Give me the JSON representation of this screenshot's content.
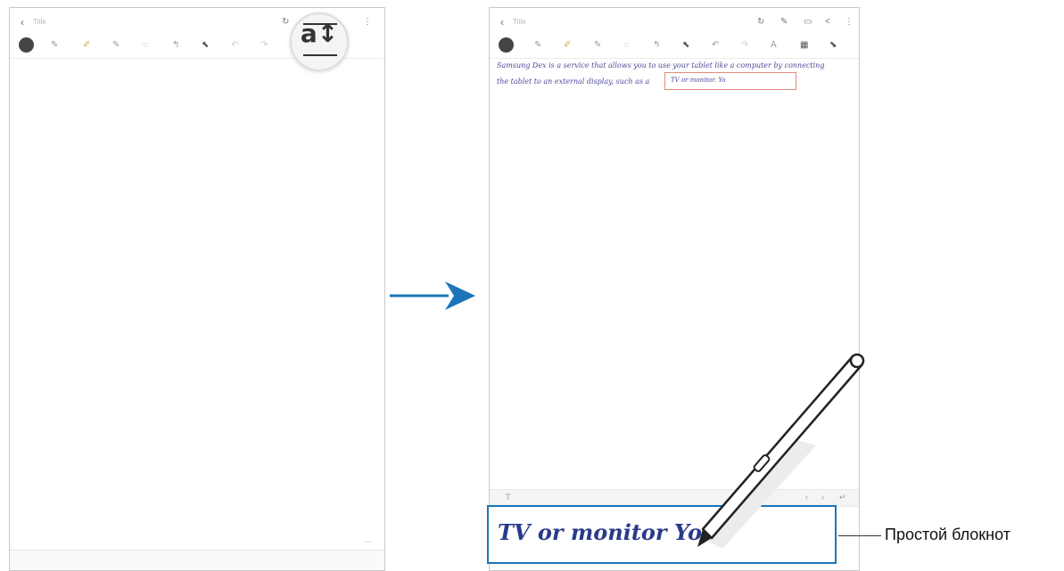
{
  "left_screen": {
    "title_placeholder": "Title",
    "actions": [
      "↻",
      "⋮"
    ],
    "toolbar_tools": [
      "✎",
      "✐",
      "✎",
      "◌",
      "↰",
      "⬉",
      "↶",
      "↷"
    ],
    "magnified_icon": "a↕"
  },
  "right_screen": {
    "title_placeholder": "Title",
    "actions": [
      "↻",
      "✎",
      "▭",
      "<",
      "⋮"
    ],
    "toolbar_tools": [
      "✎",
      "✐",
      "✎",
      "◌",
      "↰",
      "⬉",
      "↶",
      "↷",
      "A",
      "▦",
      "⬊"
    ],
    "handwriting": [
      "Samsung Dex is a service that allows you to use your tablet like a computer by connecting",
      "the tablet to an external display, such as a"
    ],
    "converted_text": "TV or monitor. Yo",
    "keyboard_row": [
      "T",
      "‹",
      "›",
      "↵"
    ],
    "pad_text": "TV or monitor You"
  },
  "callout": {
    "label": "Простой блокнот"
  },
  "colors": {
    "accent_blue": "#1b75b8",
    "ink_blue": "#2a3a8a"
  }
}
